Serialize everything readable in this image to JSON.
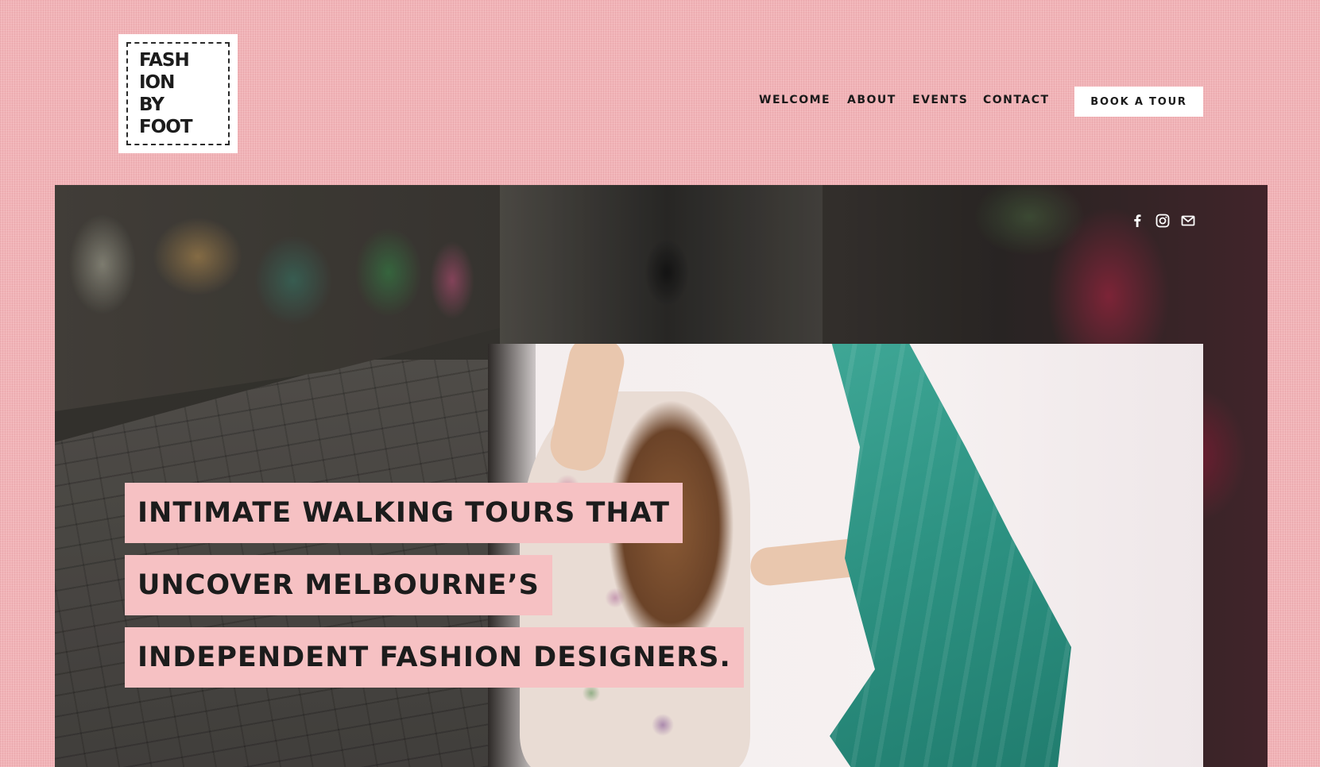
{
  "logo": {
    "lines": [
      "FASH",
      "ION",
      "BY",
      "FOOT"
    ]
  },
  "nav": {
    "items": [
      "WELCOME",
      "ABOUT",
      "EVENTS",
      "CONTACT"
    ],
    "cta_label": "BOOK A TOUR"
  },
  "social": {
    "icons": [
      "facebook-icon",
      "instagram-icon",
      "email-icon"
    ]
  },
  "hero": {
    "headline_lines": [
      "INTIMATE WALKING TOURS THAT",
      "UNCOVER MELBOURNE’S",
      "INDEPENDENT FASHION DESIGNERS."
    ]
  },
  "colors": {
    "background": "#f2b4b8",
    "headline_highlight": "#f6c1c3",
    "text": "#1c1c1c",
    "button_bg": "#ffffff"
  }
}
